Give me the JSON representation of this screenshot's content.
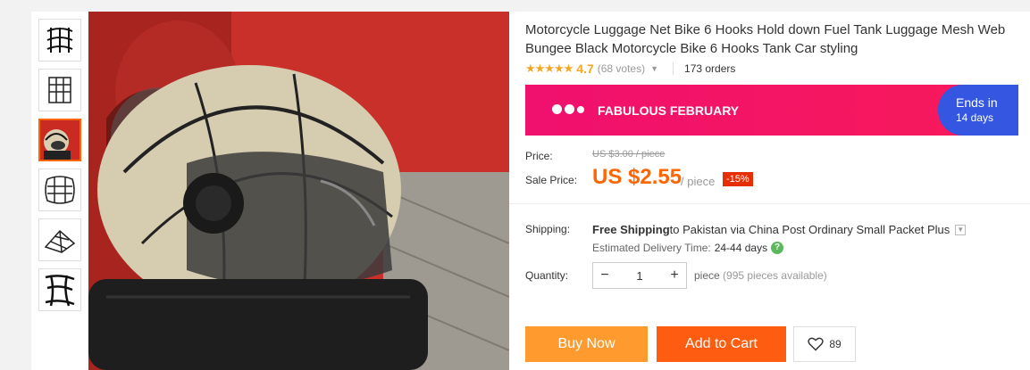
{
  "product": {
    "title": "Motorcycle Luggage Net Bike 6 Hooks Hold down Fuel Tank Luggage Mesh Web Bungee Black Motorcycle Bike 6 Hooks Tank Car styling",
    "stars": "★★★★★",
    "rating": "4.7",
    "votes": "(68 votes)",
    "orders": "173 orders"
  },
  "banner": {
    "text": "FABULOUS FEBRUARY",
    "ends_line1": "Ends in",
    "ends_line2": "14 days"
  },
  "price": {
    "price_label": "Price:",
    "original": "US $3.00 / piece",
    "sale_label": "Sale Price:",
    "sale": "US $2.55",
    "per": "/ piece",
    "discount": "-15%"
  },
  "shipping": {
    "label": "Shipping:",
    "free": "Free Shipping",
    "to": " to Pakistan via China Post Ordinary Small Packet Plus",
    "est_label": "Estimated Delivery Time:",
    "est_value": "24-44 days"
  },
  "quantity": {
    "label": "Quantity:",
    "value": "1",
    "minus": "−",
    "plus": "+",
    "unit": "piece",
    "available": " (995 pieces available)"
  },
  "actions": {
    "buy": "Buy Now",
    "cart": "Add to Cart",
    "wish_count": "89"
  },
  "icons": [
    "net-thumbnail-icon",
    "helmet-thumbnail-icon",
    "chevron-down-icon",
    "help-icon",
    "heart-icon"
  ]
}
